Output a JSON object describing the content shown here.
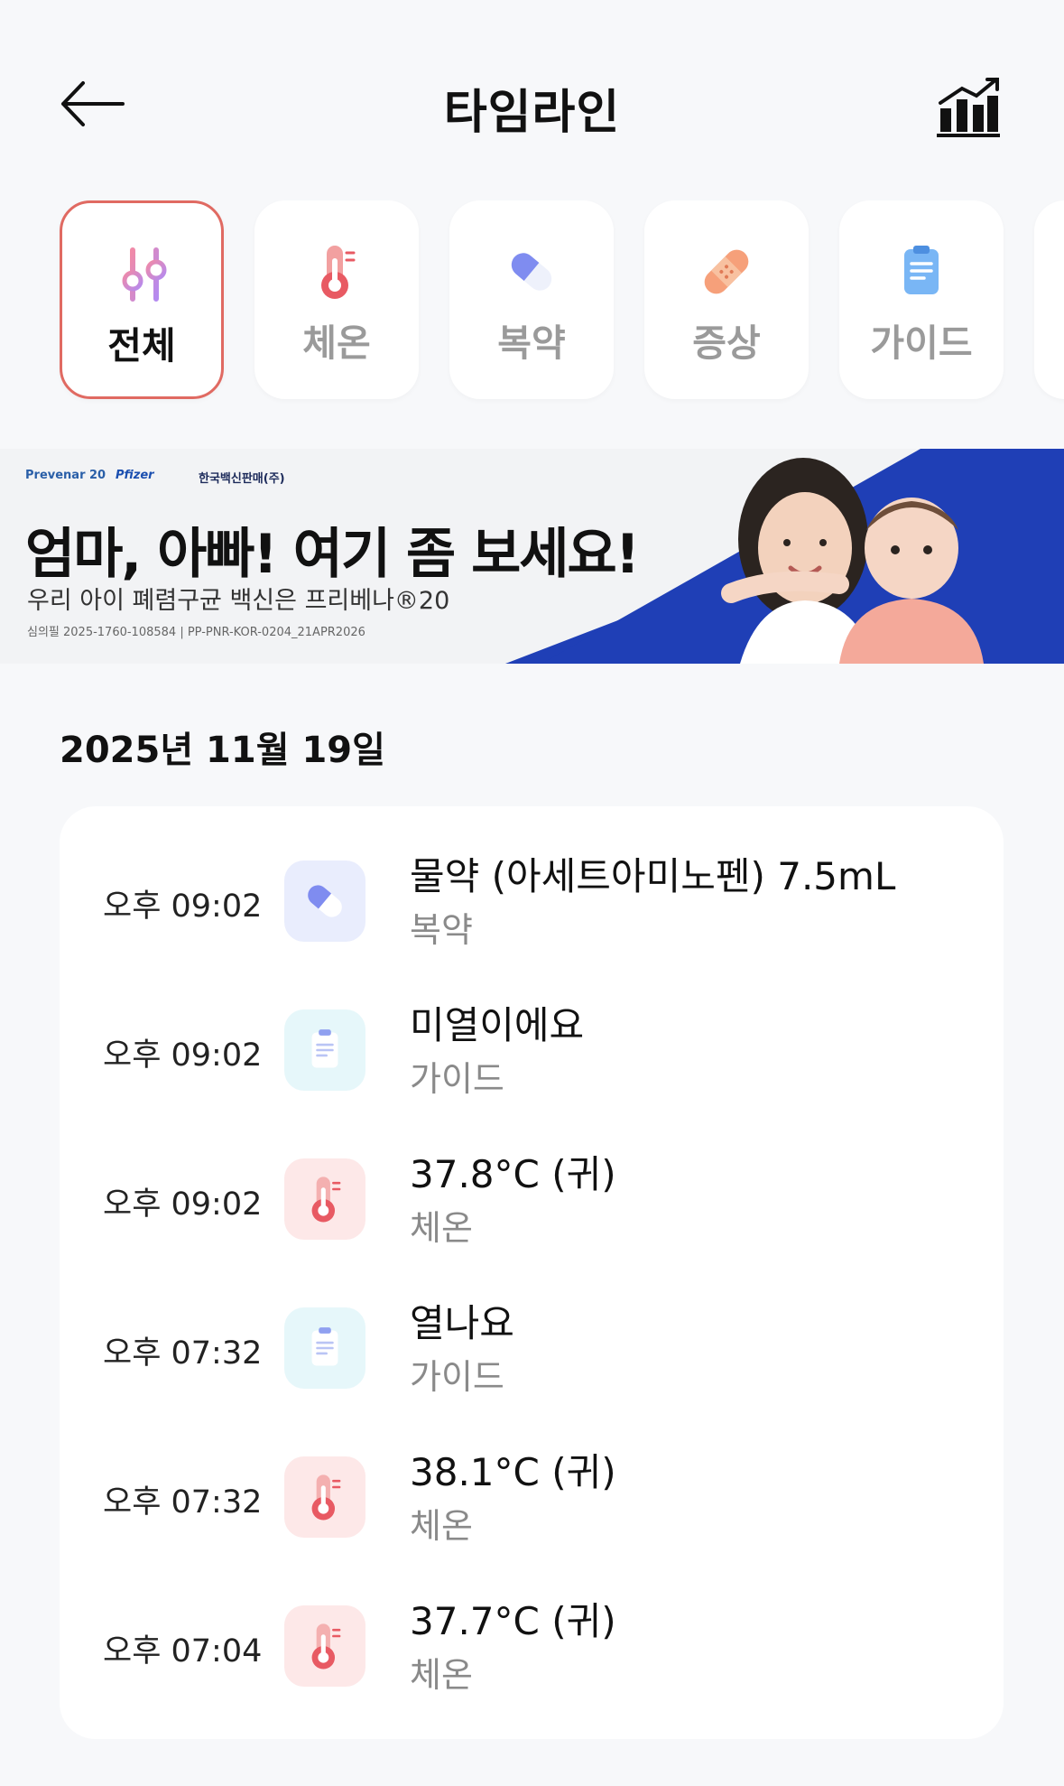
{
  "header": {
    "title": "타임라인",
    "back_icon": "arrow-left-icon",
    "chart_icon": "bar-chart-trend-icon"
  },
  "categories": [
    {
      "label": "전체",
      "icon": "filter-sliders-icon",
      "active": true
    },
    {
      "label": "체온",
      "icon": "thermometer-icon",
      "active": false
    },
    {
      "label": "복약",
      "icon": "pill-icon",
      "active": false
    },
    {
      "label": "증상",
      "icon": "bandage-icon",
      "active": false
    },
    {
      "label": "가이드",
      "icon": "clipboard-icon",
      "active": false
    }
  ],
  "banner": {
    "logo_1": "Prevenar 20",
    "logo_2": "Pfizer",
    "logo_3": "한국백신판매(주)",
    "headline": "엄마, 아빠! 여기 좀 보세요!",
    "sub": "우리 아이 폐렴구균 백신은 프리베나®20",
    "code": "심의필 2025-1760-108584 | PP-PNR-KOR-0204_21APR2026"
  },
  "date": "2025년 11월 19일",
  "entries": [
    {
      "time": "오후 09:02",
      "title": "물약 (아세트아미노펜) 7.5mL",
      "type": "복약",
      "icon": "pill-icon"
    },
    {
      "time": "오후 09:02",
      "title": "미열이에요",
      "type": "가이드",
      "icon": "clipboard-icon"
    },
    {
      "time": "오후 09:02",
      "title": "37.8°C (귀)",
      "type": "체온",
      "icon": "thermometer-icon"
    },
    {
      "time": "오후 07:32",
      "title": "열나요",
      "type": "가이드",
      "icon": "clipboard-icon"
    },
    {
      "time": "오후 07:32",
      "title": "38.1°C (귀)",
      "type": "체온",
      "icon": "thermometer-icon"
    },
    {
      "time": "오후 07:04",
      "title": "37.7°C (귀)",
      "type": "체온",
      "icon": "thermometer-icon"
    }
  ],
  "colors": {
    "accent_border": "#e06a62",
    "banner_blue": "#1f3fb6"
  }
}
